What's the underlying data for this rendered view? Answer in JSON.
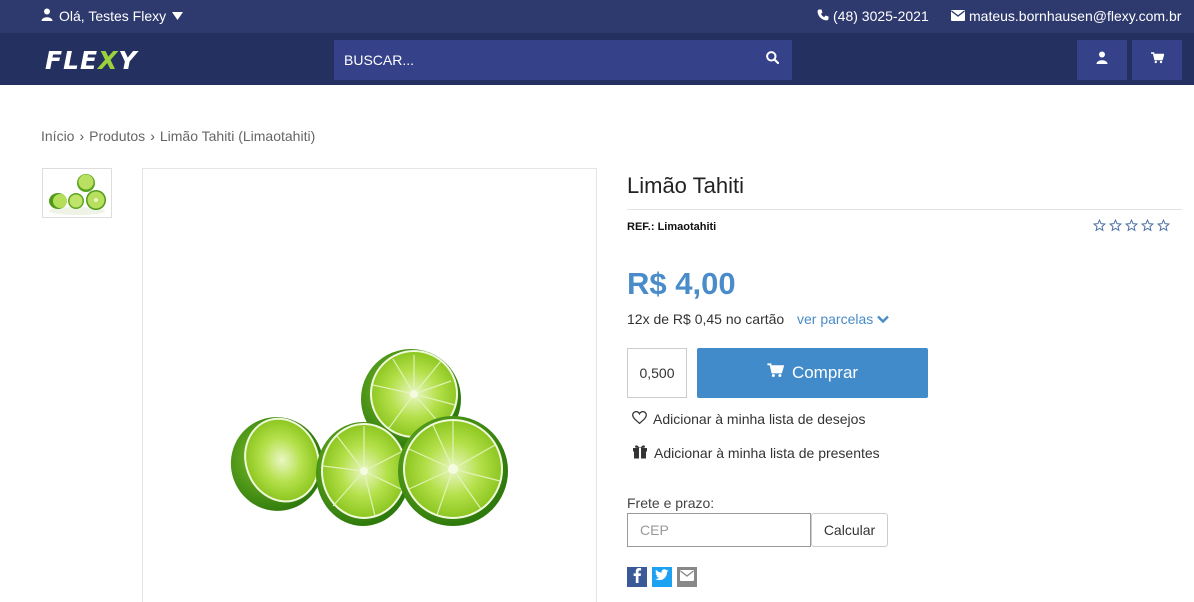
{
  "topbar": {
    "greeting": "Olá, Testes Flexy",
    "phone": "(48) 3025-2021",
    "email": "mateus.bornhausen@flexy.com.br"
  },
  "header": {
    "logo_text_left": "FLE",
    "logo_text_x": "X",
    "logo_text_right": "Y",
    "search_placeholder": "BUSCAR..."
  },
  "breadcrumb": [
    {
      "label": "Início"
    },
    {
      "label": "Produtos"
    },
    {
      "label": "Limão Tahiti (Limaotahiti)"
    }
  ],
  "product": {
    "name": "Limão Tahiti",
    "ref_label": "REF.:",
    "ref_value": "Limaotahiti",
    "rating": 0,
    "rating_max": 5,
    "price": "R$ 4,00",
    "installments": "12x de R$ 0,45 no cartão",
    "installments_link": "ver parcelas",
    "quantity": "0,500",
    "buy_label": "Comprar",
    "wishlist_label": "Adicionar à minha lista de desejos",
    "giftlist_label": "Adicionar à minha lista de presentes",
    "shipping_label": "Frete e prazo:",
    "cep_placeholder": "CEP",
    "calc_label": "Calcular"
  },
  "colors": {
    "topbar": "#2e3a6e",
    "header": "#243060",
    "search_bg": "#35428a",
    "accent": "#428bca",
    "price": "#4a8cc9",
    "logo_x": "#9bd13a",
    "facebook": "#3b5998",
    "twitter": "#1da1f2",
    "email_share": "#888888"
  },
  "icons": [
    "user-icon",
    "caret-down-icon",
    "phone-icon",
    "envelope-icon",
    "search-icon",
    "account-icon",
    "cart-icon",
    "star-icon",
    "chevron-down-icon",
    "heart-icon",
    "gift-icon",
    "facebook-icon",
    "twitter-icon",
    "email-share-icon"
  ]
}
